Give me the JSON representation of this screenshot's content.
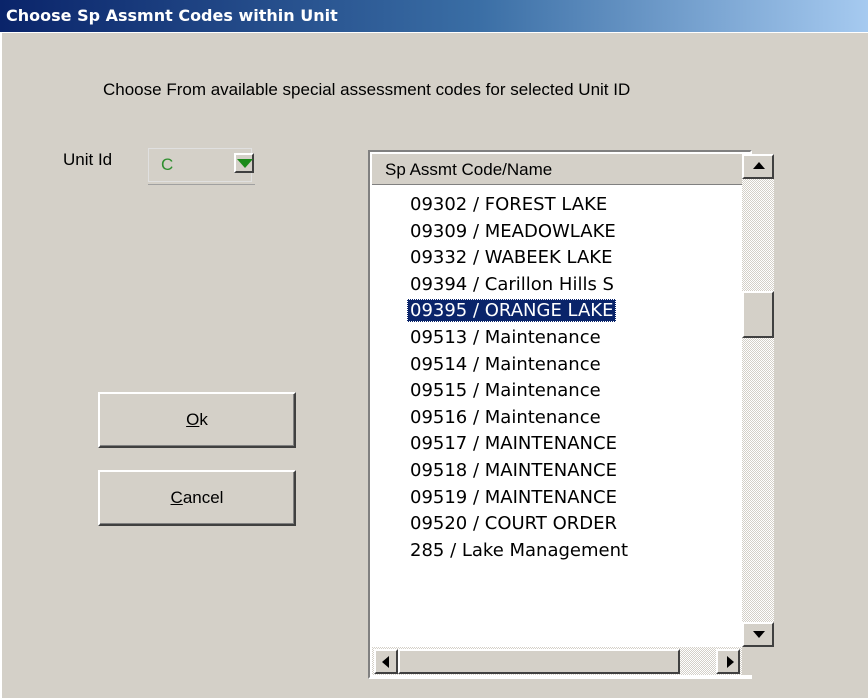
{
  "window": {
    "title": "Choose Sp Assmnt Codes within Unit"
  },
  "instruction": "Choose From available special assessment codes for selected Unit ID",
  "unit": {
    "label": "Unit Id",
    "value": "C"
  },
  "buttons": {
    "ok": "Ok",
    "cancel": "Cancel"
  },
  "list": {
    "header": "Sp Assmt Code/Name",
    "items": [
      "09302 / FOREST LAKE",
      "09309 / MEADOWLAKE",
      "09332 / WABEEK LAKE",
      "09394 / Carillon Hills S",
      "09395 / ORANGE LAKE",
      "09513 / Maintenance",
      "09514 / Maintenance",
      "09515 / Maintenance",
      "09516 / Maintenance",
      "09517 / MAINTENANCE",
      "09518 / MAINTENANCE",
      "09519 / MAINTENANCE",
      "09520 / COURT ORDER",
      "285 / Lake Management"
    ],
    "selected_index": 4
  },
  "colors": {
    "title_start": "#0a246a",
    "title_end": "#a6caf0",
    "face": "#d4d0c8",
    "selection": "#0a246a",
    "combo_text": "#2f8f2f"
  }
}
